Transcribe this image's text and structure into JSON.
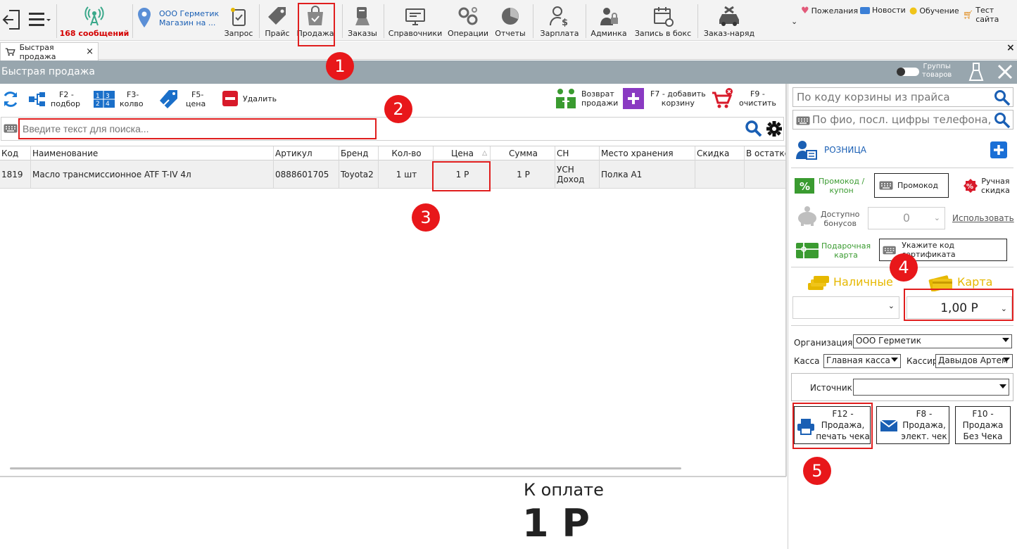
{
  "toolbar": {
    "messages": "168 сообщений",
    "org_line1": "ООО Герметик",
    "org_line2": "Магазин на ...",
    "items": [
      "Запрос",
      "Прайс",
      "Продажа",
      "Заказы",
      "Справочники",
      "Операции",
      "Отчеты",
      "Зарплата",
      "Админка",
      "Запись в бокс",
      "Заказ-наряд"
    ],
    "links": [
      "Пожелания",
      "Новости",
      "Обучение",
      "Тест сайта"
    ]
  },
  "tab": {
    "label": "Быстрая продажа",
    "close": "×"
  },
  "header": {
    "title": "Быстрая продажа",
    "groups_line1": "Группы",
    "groups_line2": "товаров"
  },
  "actions": {
    "f2_l1": "F2 -",
    "f2_l2": "подбор",
    "f3_l1": "F3-",
    "f3_l2": "колво",
    "f5_l1": "F5-",
    "f5_l2": "цена",
    "delete": "Удалить",
    "return_l1": "Возврат",
    "return_l2": "продажи",
    "f7_l1": "F7 - добавить",
    "f7_l2": "корзину",
    "f9_l1": "F9 -",
    "f9_l2": "очистить"
  },
  "search": {
    "placeholder": "Введите текст для поиска..."
  },
  "table": {
    "columns": [
      "Код",
      "Наименование",
      "Артикул",
      "Бренд",
      "Кол-во",
      "Цена",
      "Сумма",
      "СН",
      "Место хранения",
      "Скидка",
      "В остатке"
    ],
    "rows": [
      {
        "code": "1819",
        "name": "Масло трансмиссионное ATF T-IV 4л",
        "article": "0888601705",
        "brand": "Toyota2",
        "qty": "1 шт",
        "price": "1 Р",
        "sum": "1 Р",
        "sn_l1": "УСН",
        "sn_l2": "Доход",
        "storage": "Полка А1",
        "discount": "",
        "stock": ""
      }
    ]
  },
  "payment": {
    "label": "К оплате",
    "amount": "1 Р"
  },
  "right": {
    "basket_code_placeholder": "По коду корзины из прайса",
    "customer_placeholder": "По фио, посл. цифры телефона, ко",
    "customer_type": "РОЗНИЦА",
    "promo_l1": "Промокод /",
    "promo_l2": "купон",
    "promo_field": "Промокод",
    "manual_l1": "Ручная",
    "manual_l2": "скидка",
    "bonus_l1": "Доступно",
    "bonus_l2": "бонусов",
    "bonus_value": "0",
    "use": "Использовать",
    "gift_l1": "Подарочная",
    "gift_l2": "карта",
    "cert_field": "Укажите код сертификата",
    "cash": "Наличные",
    "card": "Карта",
    "cash_value": "",
    "card_value": "1,00 Р",
    "org_label": "Организация",
    "org_value": "ООО Герметик",
    "kassa_label": "Касса",
    "kassa_value": "Главная касса",
    "cashier_label": "Кассир",
    "cashier_value": "Давыдов Артем",
    "source_label": "Источник",
    "source_value": "",
    "f12_l1": "F12 -",
    "f12_l2": "Продажа,",
    "f12_l3": "печать чека",
    "f8_l1": "F8 -",
    "f8_l2": "Продажа,",
    "f8_l3": "элект. чек",
    "f10_l1": "F10 -",
    "f10_l2": "Продажа",
    "f10_l3": "Без Чека"
  },
  "annotations": [
    "1",
    "2",
    "3",
    "4",
    "5"
  ],
  "colors": {
    "accent": "#0a6fd6",
    "green": "#3a9b30",
    "red": "#e01e1e",
    "header": "#98a6ae",
    "gold": "#e6b800"
  }
}
